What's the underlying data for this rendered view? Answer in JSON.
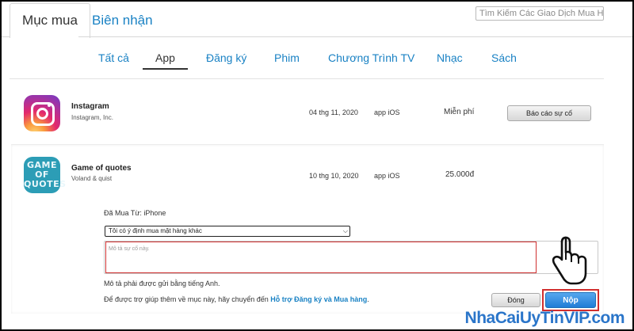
{
  "header": {
    "tabs": [
      {
        "label": "Mục mua",
        "active": true
      },
      {
        "label": "Biên nhận",
        "active": false
      }
    ],
    "search_placeholder": "Tìm Kiếm Các Giao Dịch Mua H"
  },
  "categories": [
    "Tất cả",
    "App",
    "Đăng ký",
    "Phim",
    "Chương Trình TV",
    "Nhạc",
    "Sách"
  ],
  "active_category": "App",
  "purchases": [
    {
      "name": "Instagram",
      "developer": "Instagram, Inc.",
      "date": "04 thg 11, 2020",
      "platform": "app iOS",
      "price": "Miễn phí",
      "action": "Báo cáo sự cố",
      "icon": "instagram-icon"
    },
    {
      "name": "Game of quotes",
      "developer": "Voland & quist",
      "date": "10 thg 10, 2020",
      "platform": "app iOS",
      "price": "25.000đ",
      "icon": "game-of-quotes-icon",
      "icon_text": [
        "GAME",
        "OF",
        "QUOTES"
      ]
    }
  ],
  "report_form": {
    "bought_from": "Đã Mua Từ: iPhone",
    "reason_selected": "Tôi có ý định mua mặt hàng khác",
    "description_placeholder": "Mô tả sự cố này.",
    "language_note": "Mô tả phải được gửi bằng tiếng Anh.",
    "help_text": "Để được trợ giúp thêm về mục này, hãy chuyển đến",
    "help_link": "Hỗ trợ Đăng ký và Mua hàng",
    "help_suffix": ".",
    "close_label": "Đóng",
    "submit_label": "Nộp"
  },
  "watermark": "NhaCaiUyTinVIP.com",
  "colors": {
    "link": "#1a82c4",
    "highlight": "#d12f2f",
    "submit": "#1f7dd6"
  }
}
